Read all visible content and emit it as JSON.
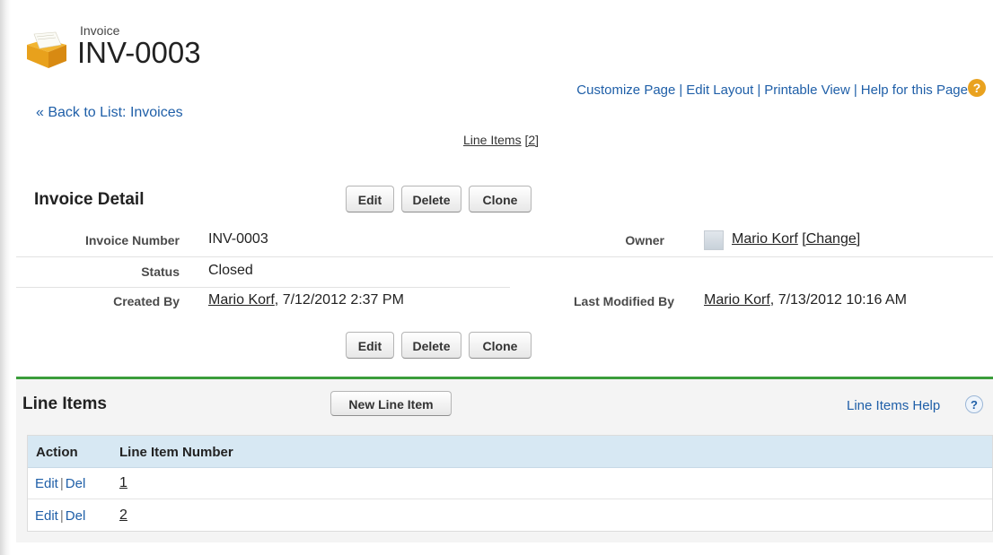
{
  "header": {
    "icon": "invoice-folder-icon",
    "record_type": "Invoice",
    "record_title": "INV-0003"
  },
  "top_links": {
    "customize_page": "Customize Page",
    "edit_layout": "Edit Layout",
    "printable_view": "Printable View",
    "help_for_page": "Help for this Page",
    "separator": "|",
    "help_icon": "?"
  },
  "back_link": "« Back to List: Invoices",
  "related_list_link": {
    "label": "Line Items",
    "count": "[2]"
  },
  "detail": {
    "title": "Invoice Detail",
    "buttons": {
      "edit": "Edit",
      "delete": "Delete",
      "clone": "Clone"
    },
    "fields": {
      "invoice_number_label": "Invoice Number",
      "invoice_number_value": "INV-0003",
      "owner_label": "Owner",
      "owner_name": "Mario Korf",
      "owner_change": "[Change]",
      "status_label": "Status",
      "status_value": "Closed",
      "created_by_label": "Created By",
      "created_by_name": "Mario Korf",
      "created_by_date": ", 7/12/2012 2:37 PM",
      "last_modified_label": "Last Modified By",
      "last_modified_name": "Mario Korf",
      "last_modified_date": ", 7/13/2012 10:16 AM"
    }
  },
  "line_items": {
    "title": "Line Items",
    "new_button": "New Line Item",
    "help_link": "Line Items Help",
    "help_icon": "?",
    "columns": [
      "Action",
      "Line Item Number"
    ],
    "rows": [
      {
        "edit": "Edit",
        "sep": "|",
        "del": "Del",
        "number": "1"
      },
      {
        "edit": "Edit",
        "sep": "|",
        "del": "Del",
        "number": "2"
      }
    ]
  },
  "colors": {
    "link": "#1f5fa8",
    "section_accent": "#3b9d3b",
    "table_header": "#d7e8f3",
    "help_badge": "#e9a21f"
  }
}
